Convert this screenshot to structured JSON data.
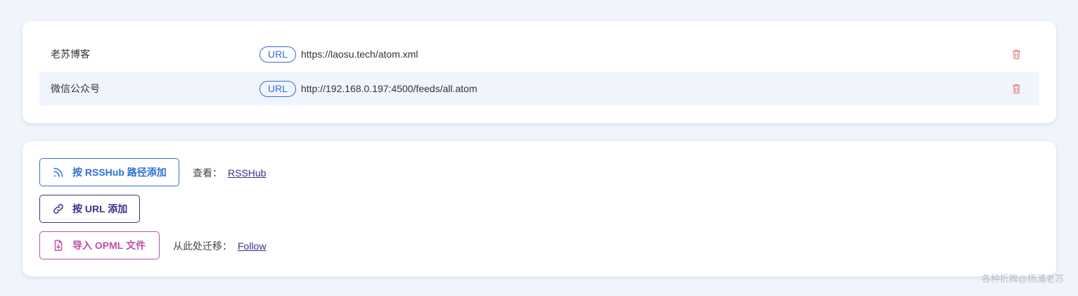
{
  "feeds": [
    {
      "name": "老苏博客",
      "badge": "URL",
      "url": "https://laosu.tech/atom.xml",
      "delete_icon": "trash-icon"
    },
    {
      "name": "微信公众号",
      "badge": "URL",
      "url": "http://192.168.0.197:4500/feeds/all.atom",
      "delete_icon": "trash-icon"
    }
  ],
  "actions": {
    "rsshub_button": {
      "label": "按 RSSHub 路径添加",
      "icon": "rss-icon",
      "color": "#2f6fd3"
    },
    "rsshub_hint": {
      "prefix": "查看：",
      "link": "RSSHub"
    },
    "url_button": {
      "label": "按 URL 添加",
      "icon": "link-icon",
      "color": "#3b2f8a"
    },
    "opml_button": {
      "label": "导入 OPML 文件",
      "icon": "file-import-icon",
      "color": "#c04fa6"
    },
    "opml_hint": {
      "prefix": "从此处迁移：",
      "link": "Follow"
    }
  },
  "watermark": "各种折腾@杨浦老苏"
}
